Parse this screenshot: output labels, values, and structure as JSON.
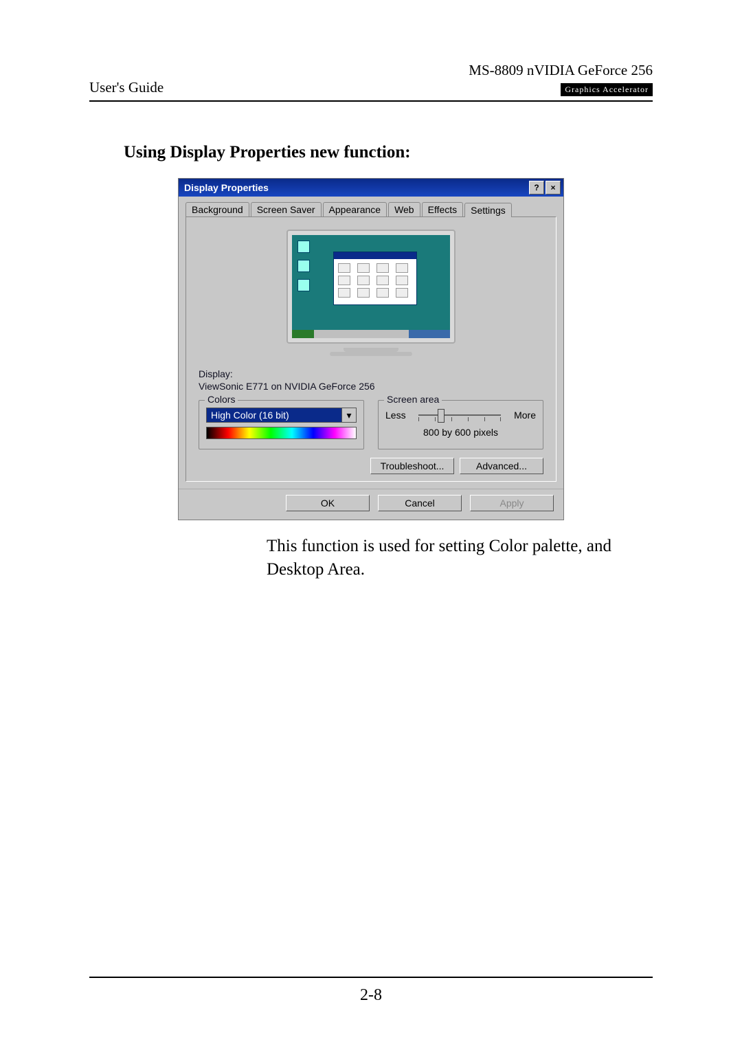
{
  "header": {
    "left": "User's Guide",
    "right_title": "MS-8809 nVIDIA GeForce 256",
    "badge": "Graphics Accelerator"
  },
  "section_heading": "Using Display Properties new function:",
  "dialog": {
    "title": "Display Properties",
    "help_symbol": "?",
    "close_symbol": "×",
    "tabs": [
      "Background",
      "Screen Saver",
      "Appearance",
      "Web",
      "Effects",
      "Settings"
    ],
    "active_tab_index": 5,
    "display_label": "Display:",
    "display_value": "ViewSonic E771 on NVIDIA GeForce 256",
    "colors": {
      "legend": "Colors",
      "value": "High Color (16 bit)"
    },
    "screen_area": {
      "legend": "Screen area",
      "less": "Less",
      "more": "More",
      "value": "800 by 600 pixels"
    },
    "troubleshoot": "Troubleshoot...",
    "advanced": "Advanced...",
    "ok": "OK",
    "cancel": "Cancel",
    "apply": "Apply"
  },
  "caption": "This function is used for setting Color palette, and Desktop Area.",
  "page_number": "2-8"
}
